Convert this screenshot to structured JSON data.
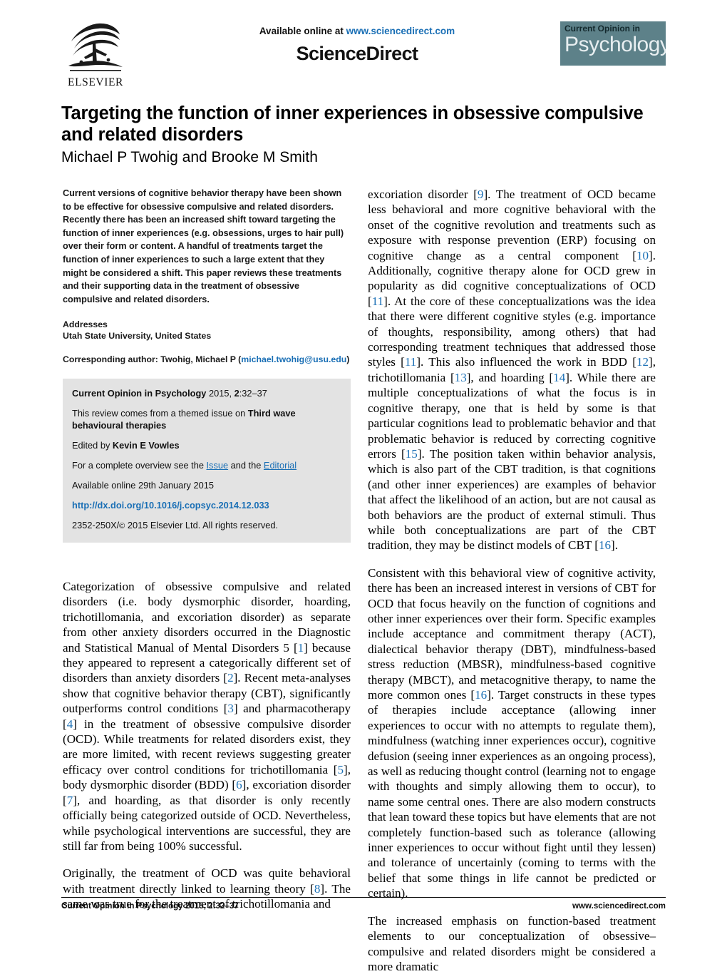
{
  "masthead": {
    "available_online": "Available online at ",
    "sciencedirect_url": "www.sciencedirect.com",
    "sciencedirect_name": "ScienceDirect",
    "publisher_name": "ELSEVIER",
    "journal_logo_top": "Current Opinion in",
    "journal_logo_bottom": "Psychology"
  },
  "article": {
    "title": "Targeting the function of inner experiences in obsessive compulsive and related disorders",
    "authors": "Michael P Twohig and Brooke M Smith",
    "abstract": "Current versions of cognitive behavior therapy have been shown to be effective for obsessive compulsive and related disorders. Recently there has been an increased shift toward targeting the function of inner experiences (e.g. obsessions, urges to hair pull) over their form or content. A handful of treatments target the function of inner experiences to such a large extent that they might be considered a shift. This paper reviews these treatments and their supporting data in the treatment of obsessive compulsive and related disorders.",
    "addresses_heading": "Addresses",
    "addresses_body": "Utah State University, United States",
    "corresponding_prefix": "Corresponding author: Twohig, Michael P (",
    "corresponding_email": "michael.twohig@usu.edu",
    "corresponding_suffix": ")"
  },
  "infobox": {
    "citation_journal": "Current Opinion in Psychology",
    "citation_rest": " 2015, ",
    "citation_volume": "2",
    "citation_pages": ":32–37",
    "themed_issue_prefix": "This review comes from a themed issue on ",
    "themed_issue_title": "Third wave behavioural therapies",
    "edited_by_prefix": "Edited by ",
    "edited_by_name": "Kevin E Vowles",
    "overview_prefix": "For a complete overview see the ",
    "overview_link_issue": "Issue",
    "overview_mid": " and the ",
    "overview_link_editorial": "Editorial",
    "available_online_date": "Available online 29th January 2015",
    "doi": "http://dx.doi.org/10.1016/j.copsyc.2014.12.033",
    "issn_line_prefix": "2352-250X/",
    "issn_line_suffix": " 2015 Elsevier Ltd. All rights reserved."
  },
  "body": {
    "left_paragraphs": [
      "Categorization of obsessive compulsive and related disorders (i.e. body dysmorphic disorder, hoarding, trichotillomania, and excoriation disorder) as separate from other anxiety disorders occurred in the Diagnostic and Statistical Manual of Mental Disorders 5 [1] because they appeared to represent a categorically different set of disorders than anxiety disorders [2]. Recent meta-analyses show that cognitive behavior therapy (CBT), significantly outperforms control conditions [3] and pharmacotherapy [4] in the treatment of obsessive compulsive disorder (OCD). While treatments for related disorders exist, they are more limited, with recent reviews suggesting greater efficacy over control conditions for trichotillomania [5], body dysmorphic disorder (BDD) [6], excoriation disorder [7], and hoarding, as that disorder is only recently officially being categorized outside of OCD. Nevertheless, while psychological interventions are successful, they are still far from being 100% successful.",
      "Originally, the treatment of OCD was quite behavioral with treatment directly linked to learning theory [8]. The same was true for the treatment of trichotillomania and"
    ],
    "right_paragraphs": [
      "excoriation disorder [9]. The treatment of OCD became less behavioral and more cognitive behavioral with the onset of the cognitive revolution and treatments such as exposure with response prevention (ERP) focusing on cognitive change as a central component [10]. Additionally, cognitive therapy alone for OCD grew in popularity as did cognitive conceptualizations of OCD [11]. At the core of these conceptualizations was the idea that there were different cognitive styles (e.g. importance of thoughts, responsibility, among others) that had corresponding treatment techniques that addressed those styles [11]. This also influenced the work in BDD [12], trichotillomania [13], and hoarding [14]. While there are multiple conceptualizations of what the focus is in cognitive therapy, one that is held by some is that particular cognitions lead to problematic behavior and that problematic behavior is reduced by correcting cognitive errors [15]. The position taken within behavior analysis, which is also part of the CBT tradition, is that cognitions (and other inner experiences) are examples of behavior that affect the likelihood of an action, but are not causal as both behaviors are the product of external stimuli. Thus while both conceptualizations are part of the CBT tradition, they may be distinct models of CBT [16].",
      "Consistent with this behavioral view of cognitive activity, there has been an increased interest in versions of CBT for OCD that focus heavily on the function of cognitions and other inner experiences over their form. Specific examples include acceptance and commitment therapy (ACT), dialectical behavior therapy (DBT), mindfulness-based stress reduction (MBSR), mindfulness-based cognitive therapy (MBCT), and metacognitive therapy, to name the more common ones [16]. Target constructs in these types of therapies include acceptance (allowing inner experiences to occur with no attempts to regulate them), mindfulness (watching inner experiences occur), cognitive defusion (seeing inner experiences as an ongoing process), as well as reducing thought control (learning not to engage with thoughts and simply allowing them to occur), to name some central ones. There are also modern constructs that lean toward these topics but have elements that are not completely function-based such as tolerance (allowing inner experiences to occur without fight until they lessen) and tolerance of uncertainly (coming to terms with the belief that some things in life cannot be predicted or certain).",
      "The increased emphasis on function-based treatment elements to our conceptualization of obsessive–compulsive and related disorders might be considered a more dramatic"
    ]
  },
  "footer": {
    "journal": "Current Opinion in Psychology",
    "citation": " 2015, 2:32–37",
    "website": "www.sciencedirect.com"
  },
  "colors": {
    "link_blue": "#1a6fb5",
    "journal_logo_bg": "#5d8189",
    "infobox_bg": "#e3e3e3"
  }
}
